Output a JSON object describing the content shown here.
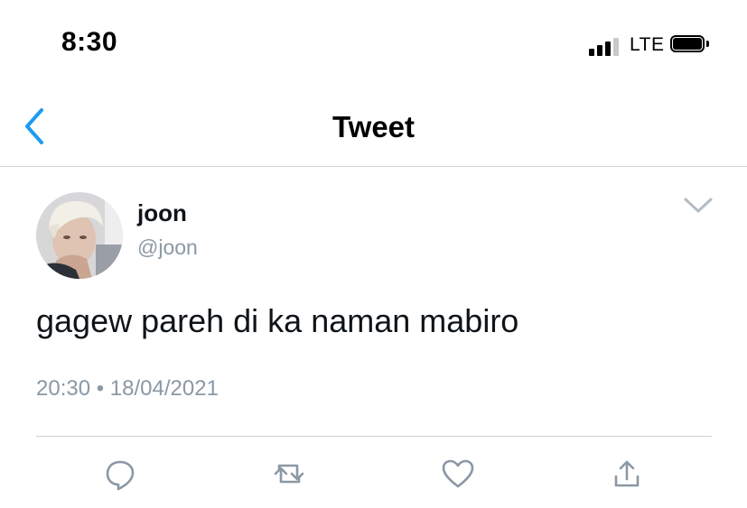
{
  "status_bar": {
    "time": "8:30",
    "network": "LTE"
  },
  "nav": {
    "title": "Tweet",
    "back_icon": "chevron-left-icon"
  },
  "tweet": {
    "author_name": "joon",
    "author_handle": "@joon",
    "text": "gagew pareh di ka naman mabiro",
    "timestamp": "20:30 • 18/04/2021"
  },
  "actions": [
    "reply-icon",
    "retweet-icon",
    "like-icon",
    "share-icon"
  ],
  "colors": {
    "accent": "#1d9bf0",
    "secondary_text": "#8b98a5",
    "icon_gray": "#8b98a5",
    "divider": "#cfd4d9"
  }
}
